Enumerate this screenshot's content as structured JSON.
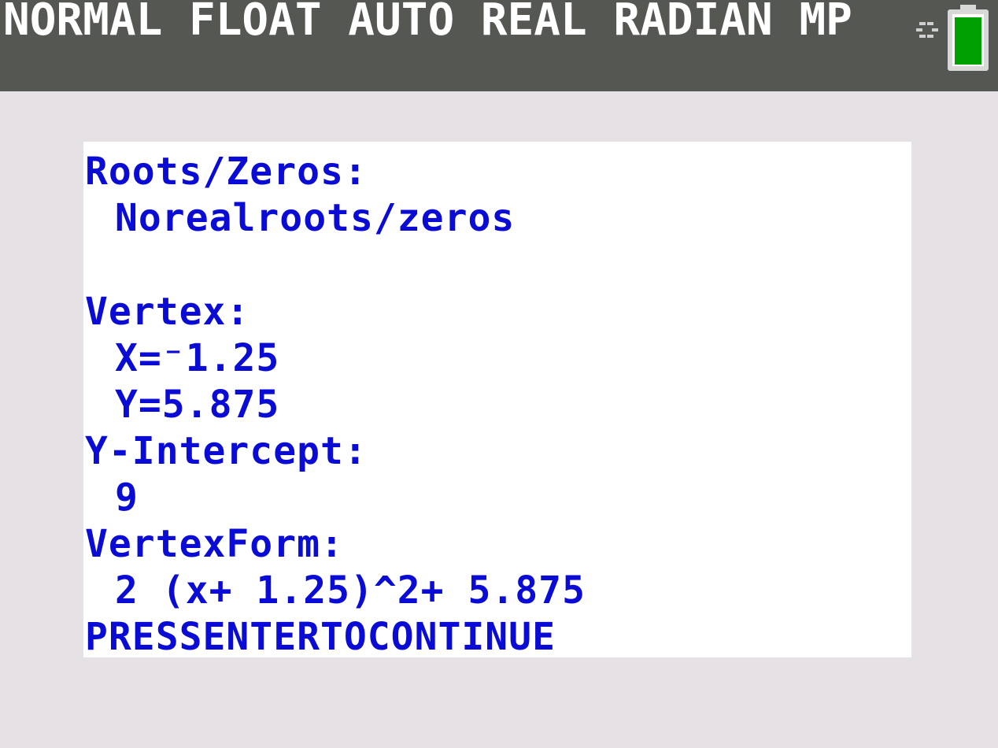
{
  "status_bar": {
    "mode_text": "NORMAL FLOAT AUTO REAL RADIAN MP",
    "background": "#555753",
    "text_color": "#ffffff",
    "battery_level_fraction": 1.0,
    "battery_color": "#00a000",
    "icons": [
      "busy-indicator-icon",
      "battery-icon"
    ]
  },
  "output": {
    "text_color": "#0b0bd6",
    "roots_heading": "Roots/Zeros:",
    "roots_value": "Norealroots/zeros",
    "vertex_heading": "Vertex:",
    "vertex_x": "X=⁻1.25",
    "vertex_y": "Y=5.875",
    "y_intercept_heading": "Y-Intercept:",
    "y_intercept_value": "9",
    "vertex_form_heading": "VertexForm:",
    "vertex_form_value": "2 (x+ 1.25)^2+ 5.875",
    "continue_prompt": "PRESSENTERTOCONTINUE"
  }
}
